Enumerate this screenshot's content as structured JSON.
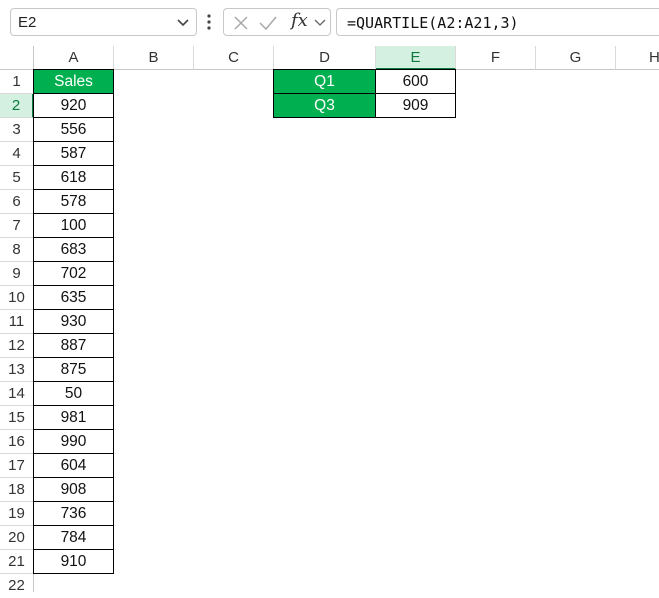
{
  "formula_bar": {
    "name_box": "E2",
    "fx_label": "fx",
    "formula": "=QUARTILE(A2:A21,3)"
  },
  "columns": [
    "A",
    "B",
    "C",
    "D",
    "E",
    "F",
    "G",
    "H"
  ],
  "rows": [
    "1",
    "2",
    "3",
    "4",
    "5",
    "6",
    "7",
    "8",
    "9",
    "10",
    "11",
    "12",
    "13",
    "14",
    "15",
    "16",
    "17",
    "18",
    "19",
    "20",
    "21",
    "22"
  ],
  "sales_table": {
    "header": "Sales",
    "values": [
      "920",
      "556",
      "587",
      "618",
      "578",
      "100",
      "683",
      "702",
      "635",
      "930",
      "887",
      "875",
      "50",
      "981",
      "990",
      "604",
      "908",
      "736",
      "784",
      "910"
    ]
  },
  "quartile_table": {
    "rows": [
      {
        "label": "Q1",
        "value": "600"
      },
      {
        "label": "Q3",
        "value": "909"
      }
    ]
  },
  "colors": {
    "header_fill": "#00b050",
    "selection": "#107c41"
  },
  "selected_cell": "E2"
}
